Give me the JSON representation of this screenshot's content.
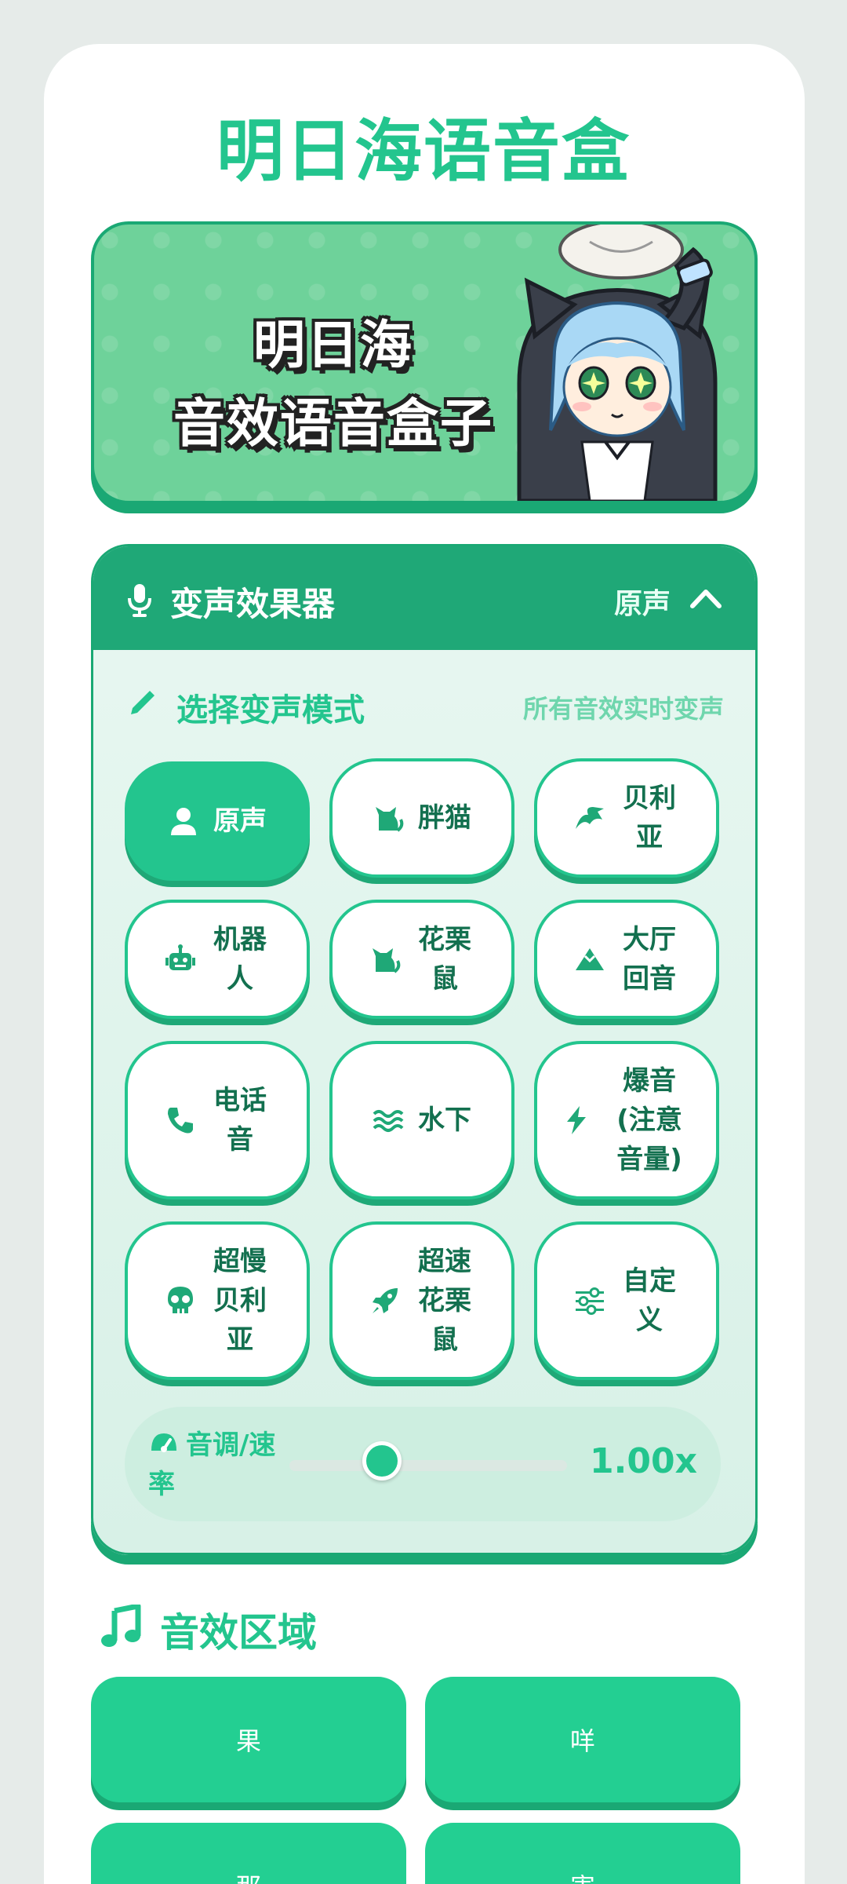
{
  "app": {
    "title": "明日海语音盒"
  },
  "banner": {
    "line1": "明日海",
    "line2": "音效语音盒子"
  },
  "voice_changer": {
    "title": "变声效果器",
    "current": "原声",
    "mode_label": "选择变声模式",
    "mode_hint": "所有音效实时变声",
    "modes": [
      {
        "label": "原声",
        "icon": "user-icon",
        "active": true
      },
      {
        "label": "胖猫",
        "icon": "cat-icon"
      },
      {
        "label": "贝利亚",
        "icon": "dragon-icon"
      },
      {
        "label": "机器人",
        "icon": "robot-icon"
      },
      {
        "label": "花栗鼠",
        "icon": "cat-icon"
      },
      {
        "label": "大厅回音",
        "icon": "mountain-icon"
      },
      {
        "label": "电话音",
        "icon": "phone-icon"
      },
      {
        "label": "水下",
        "icon": "water-icon"
      },
      {
        "label": "爆音(注意音量)",
        "icon": "bolt-icon"
      },
      {
        "label": "超慢贝利亚",
        "icon": "skull-icon"
      },
      {
        "label": "超速花栗鼠",
        "icon": "rocket-icon"
      },
      {
        "label": "自定义",
        "icon": "sliders-icon"
      }
    ],
    "pitch": {
      "label": "音调/速率",
      "value": 1.0,
      "display": "1.00x"
    }
  },
  "sounds": {
    "title": "音效区域",
    "items": [
      "果",
      "咩",
      "那",
      "害"
    ]
  },
  "colors": {
    "accent": "#23c58e",
    "accent_dark": "#1fa877",
    "panel_bg": "#e8f7f1"
  }
}
